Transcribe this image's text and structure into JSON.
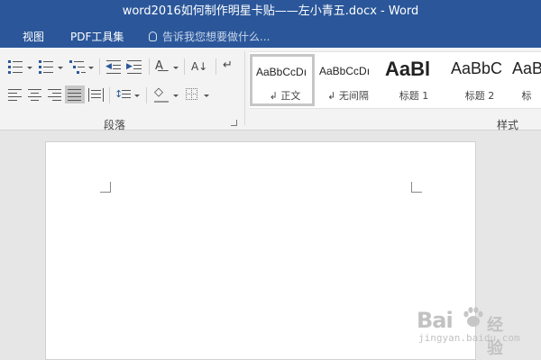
{
  "window": {
    "title": "word2016如何制作明星卡贴——左小青五.docx - Word"
  },
  "menu": {
    "items": [
      "视图",
      "PDF工具集"
    ],
    "tell_me": "告诉我您想要做什么..."
  },
  "ribbon": {
    "paragraph_group": "段落",
    "styles_group": "样式",
    "styles": [
      {
        "preview": "AaBbCcDı",
        "name": "↲ 正文",
        "selected": true
      },
      {
        "preview": "AaBbCcDı",
        "name": "↲ 无间隔",
        "selected": false
      },
      {
        "preview": "AaBl",
        "name": "标题 1",
        "selected": false
      },
      {
        "preview": "AaBbC",
        "name": "标题 2",
        "selected": false
      },
      {
        "preview": "AaB",
        "name": "标",
        "selected": false
      }
    ],
    "icons": [
      "bullets-icon",
      "numbering-icon",
      "multilevel-list-icon",
      "decrease-indent-icon",
      "increase-indent-icon",
      "chinese-layout-icon",
      "sort-icon",
      "show-formatting-icon",
      "align-left-icon",
      "align-center-icon",
      "align-right-icon",
      "justify-icon",
      "distributed-icon",
      "line-spacing-icon",
      "shading-icon",
      "borders-icon"
    ]
  },
  "watermark": {
    "brand": "Bai",
    "brand2": "经验",
    "url": "jingyan.baidu.com"
  }
}
